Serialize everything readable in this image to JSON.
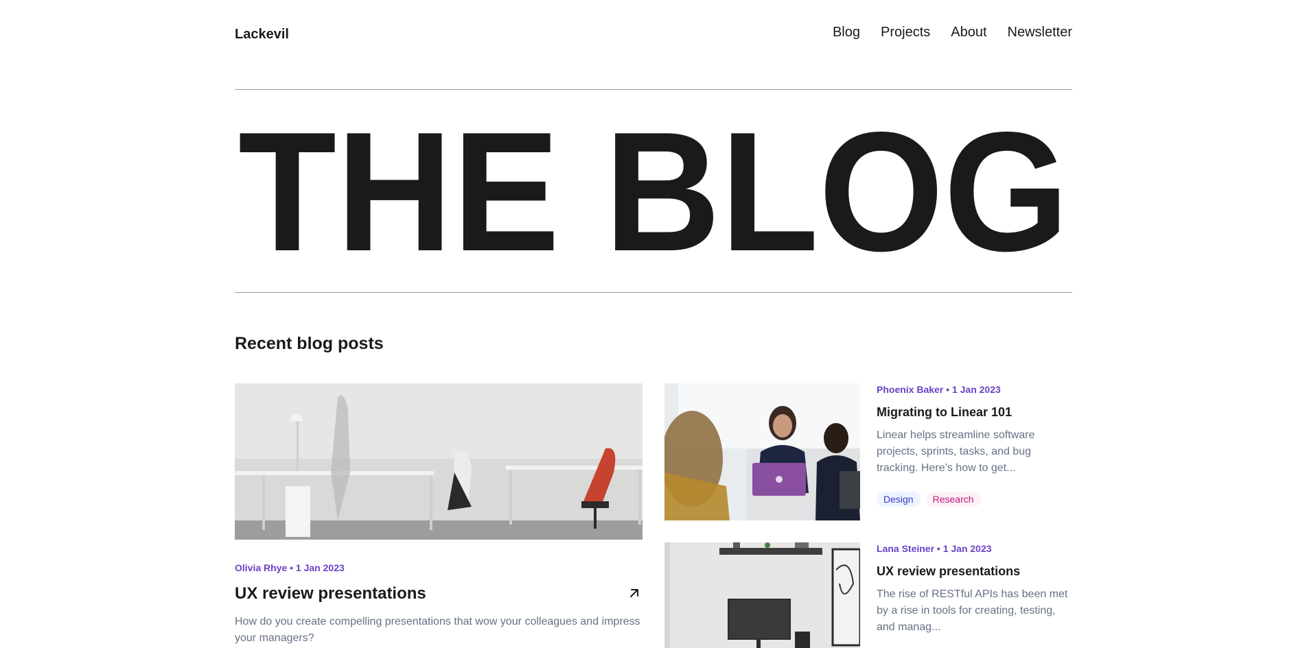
{
  "header": {
    "brand": "Lackevil",
    "nav": [
      {
        "label": "Blog"
      },
      {
        "label": "Projects"
      },
      {
        "label": "About"
      },
      {
        "label": "Newsletter"
      }
    ]
  },
  "hero": {
    "title": "THE BLOG"
  },
  "section": {
    "title": "Recent blog posts"
  },
  "featured_post": {
    "meta": "Olivia Rhye • 1 Jan 2023",
    "title": "UX review presentations",
    "excerpt": "How do you create compelling presentations that wow your colleagues and impress your managers?",
    "arrow_icon": "arrow-up-right-icon",
    "image": "office-desks-chairs-photo"
  },
  "side_posts": [
    {
      "meta": "Phoenix Baker • 1 Jan 2023",
      "title": "Migrating to Linear 101",
      "excerpt": "Linear helps streamline software projects, sprints, tasks, and bug tracking. Here’s how to get...",
      "tags": [
        {
          "label": "Design"
        },
        {
          "label": "Research"
        }
      ],
      "image": "meeting-laptop-photo"
    },
    {
      "meta": "Lana Steiner • 1 Jan 2023",
      "title": "UX review presentations",
      "excerpt": "The rise of RESTful APIs has been met by a rise in tools for creating, testing, and manag...",
      "image": "desk-monitor-photo"
    }
  ],
  "colors": {
    "accent": "#6941c6",
    "text": "#1a1a1a",
    "muted": "#667085",
    "tag_design_bg": "#eef4ff",
    "tag_design_text": "#3538cd",
    "tag_research_bg": "#fdf2fa",
    "tag_research_text": "#c11574"
  }
}
